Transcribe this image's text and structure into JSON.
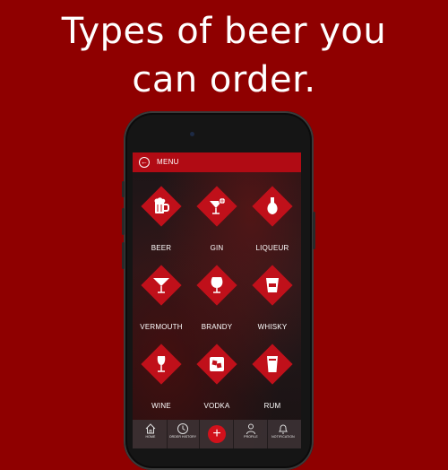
{
  "headline": {
    "line1": "Types of beer you",
    "line2": "can order."
  },
  "colors": {
    "background": "#8f0000",
    "accent": "#c0101a",
    "topbar": "#b10b14"
  },
  "app": {
    "header": {
      "back_icon": "back-arrow-icon",
      "title": "MENU"
    },
    "categories": [
      {
        "label": "BEER",
        "icon": "beer-mug-icon"
      },
      {
        "label": "GIN",
        "icon": "cocktail-glass-icon"
      },
      {
        "label": "LIQUEUR",
        "icon": "liqueur-bottle-icon"
      },
      {
        "label": "VERMOUTH",
        "icon": "martini-glass-icon"
      },
      {
        "label": "BRANDY",
        "icon": "brandy-snifter-icon"
      },
      {
        "label": "WHISKY",
        "icon": "whisky-glass-icon"
      },
      {
        "label": "WINE",
        "icon": "wine-glass-icon"
      },
      {
        "label": "VODKA",
        "icon": "vodka-glass-icon"
      },
      {
        "label": "RUM",
        "icon": "rum-glass-icon"
      }
    ],
    "bottom_nav": [
      {
        "label": "HOME",
        "icon": "home-icon"
      },
      {
        "label": "ORDER HISTORY",
        "icon": "clock-icon"
      },
      {
        "label": "",
        "icon": "plus-icon"
      },
      {
        "label": "PROFILE",
        "icon": "person-icon"
      },
      {
        "label": "NOTIFICATION",
        "icon": "bell-icon"
      }
    ]
  }
}
